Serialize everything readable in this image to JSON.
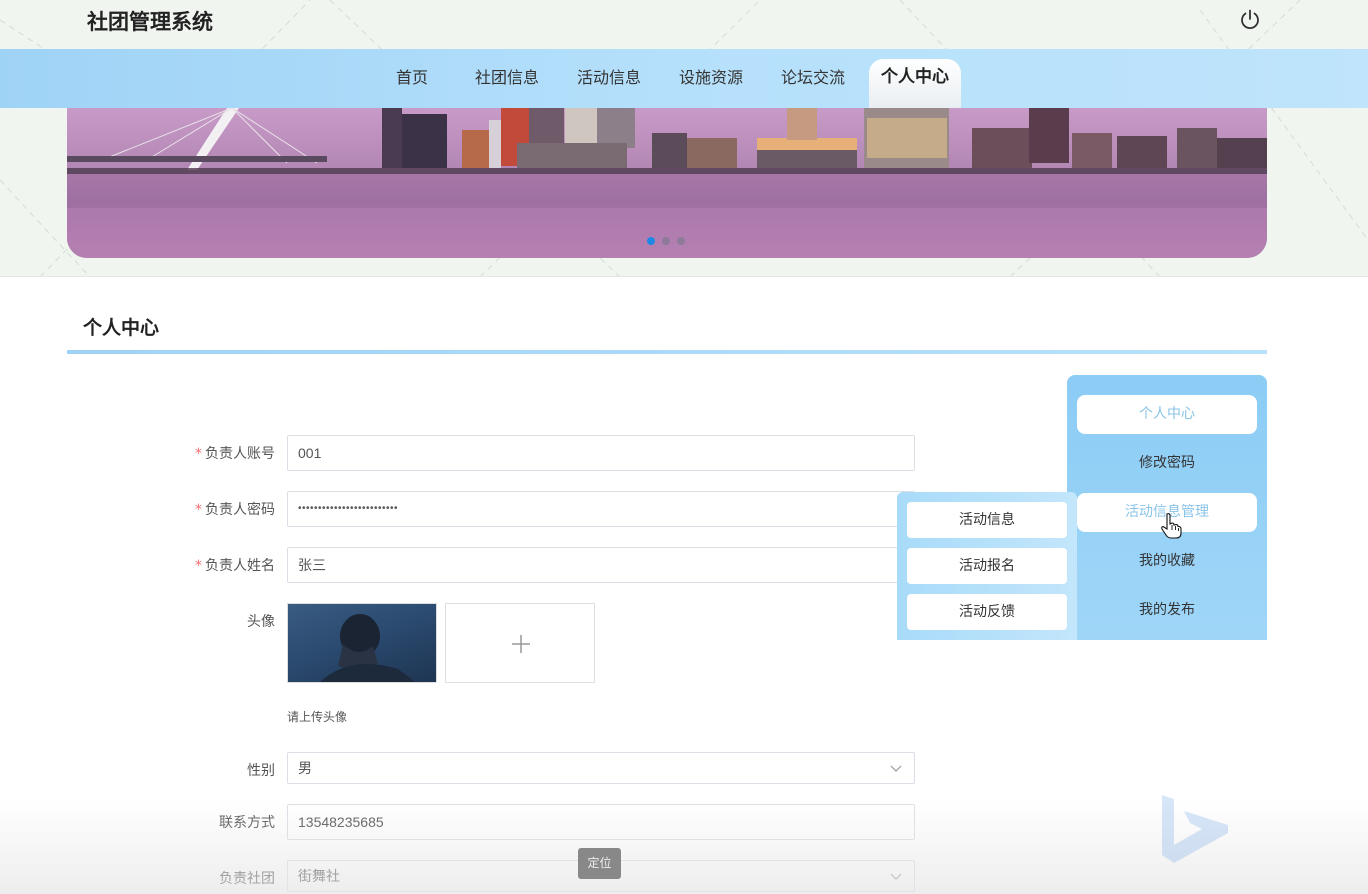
{
  "header": {
    "title": "社团管理系统"
  },
  "nav": {
    "items": [
      {
        "label": "首页"
      },
      {
        "label": "社团信息"
      },
      {
        "label": "活动信息"
      },
      {
        "label": "设施资源"
      },
      {
        "label": "论坛交流"
      },
      {
        "label": "个人中心"
      }
    ],
    "active_index": 5
  },
  "banner": {
    "slide_count": 3,
    "active_slide": 0
  },
  "section": {
    "title": "个人中心"
  },
  "form": {
    "account": {
      "label": "负责人账号",
      "value": "001",
      "required": true
    },
    "password": {
      "label": "负责人密码",
      "value": "•••••••••••••••••••••••••",
      "required": true
    },
    "name": {
      "label": "负责人姓名",
      "value": "张三",
      "required": true
    },
    "avatar": {
      "label": "头像",
      "hint": "请上传头像"
    },
    "gender": {
      "label": "性别",
      "value": "男"
    },
    "phone": {
      "label": "联系方式",
      "value": "13548235685"
    },
    "club": {
      "label": "负责社团",
      "value": "街舞社"
    }
  },
  "side_menu": {
    "items": [
      {
        "label": "个人中心"
      },
      {
        "label": "修改密码"
      },
      {
        "label": "活动信息管理"
      },
      {
        "label": "我的收藏"
      },
      {
        "label": "我的发布"
      }
    ]
  },
  "sub_menu": {
    "items": [
      {
        "label": "活动信息"
      },
      {
        "label": "活动报名"
      },
      {
        "label": "活动反馈"
      }
    ]
  },
  "floating": {
    "locate_label": "定位"
  },
  "colors": {
    "accent": "#9fd3f6",
    "required": "#f56c6c",
    "active_dot": "#1e88e5"
  }
}
